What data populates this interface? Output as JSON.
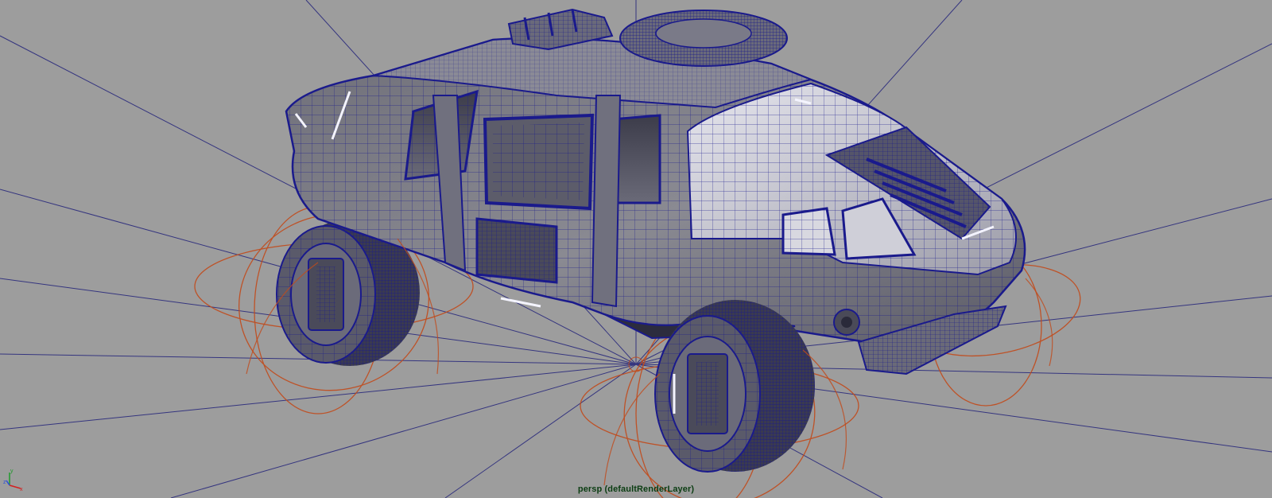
{
  "viewport": {
    "camera_label": "persp (defaultRenderLayer)",
    "axes": {
      "x": "x",
      "y": "y",
      "z": "z"
    },
    "colors": {
      "background": "#9d9d9d",
      "wireframe": "#1a1a8c",
      "joint_curves": "#c24a1a",
      "axis_x": "#d42020",
      "axis_y": "#1f9a2a",
      "axis_z": "#2a4fd8",
      "label": "#0b3d12"
    },
    "objects": [
      "vehicle-body-mesh",
      "front-left-wheel",
      "front-right-wheel",
      "spare-tire",
      "roof-rack",
      "wheel-control-curves"
    ]
  }
}
